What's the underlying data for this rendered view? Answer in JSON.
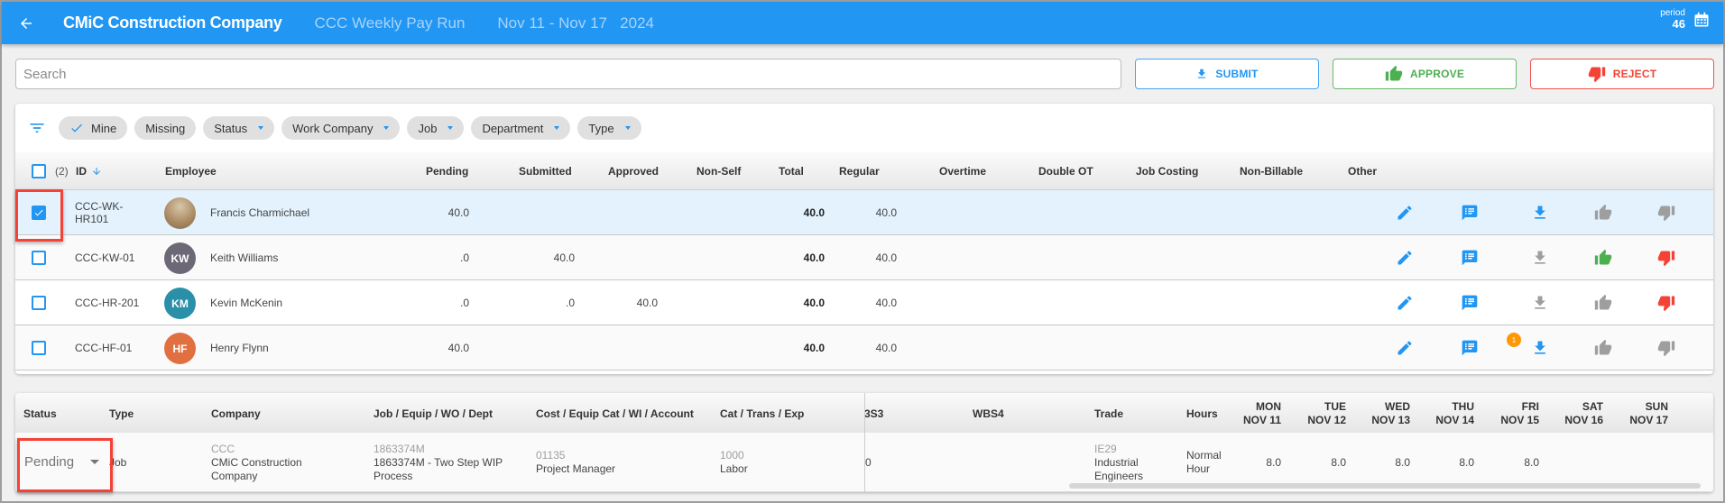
{
  "appbar": {
    "title": "CMiC Construction Company",
    "pay_run": "CCC Weekly Pay Run",
    "date_range": "Nov 11 - Nov 17",
    "year": "2024",
    "period_label": "period",
    "period_number": "46",
    "back_icon": "arrow-left-icon",
    "calendar_icon": "calendar-icon"
  },
  "search": {
    "placeholder": "Search",
    "value": ""
  },
  "actions": {
    "submit": "SUBMIT",
    "approve": "APPROVE",
    "reject": "REJECT"
  },
  "filters": {
    "chips": [
      {
        "label": "Mine",
        "checked": true
      },
      {
        "label": "Missing"
      },
      {
        "label": "Status",
        "dropdown": true
      },
      {
        "label": "Work Company",
        "dropdown": true
      },
      {
        "label": "Job",
        "dropdown": true
      },
      {
        "label": "Department",
        "dropdown": true
      },
      {
        "label": "Type",
        "dropdown": true
      }
    ]
  },
  "employee_table": {
    "selected_count": "(2)",
    "columns": [
      "ID",
      "Employee",
      "Pending",
      "Submitted",
      "Approved",
      "Non-Self",
      "Total",
      "Regular",
      "Overtime",
      "Double OT",
      "Job Costing",
      "Non-Billable",
      "Other"
    ],
    "rows": [
      {
        "checked": true,
        "id": "CCC-WK-HR101",
        "id_line1": "CCC-WK-",
        "id_line2": "HR101",
        "name": "Francis Charmichael",
        "initials": "",
        "avatar_color": "",
        "pending": "40.0",
        "submitted": "",
        "approved": "",
        "total": "40.0",
        "regular": "40.0",
        "download_active": true,
        "approve_state": "disabled",
        "reject_state": "disabled",
        "badge": ""
      },
      {
        "checked": false,
        "id": "CCC-KW-01",
        "name": "Keith Williams",
        "initials": "KW",
        "avatar_color": "#6d6875",
        "pending": ".0",
        "submitted": "40.0",
        "approved": "",
        "total": "40.0",
        "regular": "40.0",
        "download_active": false,
        "approve_state": "active",
        "reject_state": "active",
        "badge": ""
      },
      {
        "checked": false,
        "id": "CCC-HR-201",
        "name": "Kevin McKenin",
        "initials": "KM",
        "avatar_color": "#2a8fa8",
        "pending": ".0",
        "submitted": ".0",
        "approved": "40.0",
        "total": "40.0",
        "regular": "40.0",
        "download_active": false,
        "approve_state": "disabled",
        "reject_state": "active",
        "badge": ""
      },
      {
        "checked": false,
        "id": "CCC-HF-01",
        "name": "Henry Flynn",
        "initials": "HF",
        "avatar_color": "#e07040",
        "pending": "40.0",
        "submitted": "",
        "approved": "",
        "total": "40.0",
        "regular": "40.0",
        "download_active": true,
        "approve_state": "disabled",
        "reject_state": "disabled",
        "badge": "1"
      }
    ]
  },
  "detail_table": {
    "columns": {
      "status": "Status",
      "type": "Type",
      "company": "Company",
      "job": "Job / Equip / WO / Dept",
      "cost": "Cost / Equip Cat / WI / Account",
      "cat": "Cat / Trans / Exp",
      "wbs3": "3S3",
      "wbs4": "WBS4",
      "trade": "Trade",
      "hours": "Hours",
      "days": [
        {
          "day": "MON",
          "date": "NOV 11"
        },
        {
          "day": "TUE",
          "date": "NOV 12"
        },
        {
          "day": "WED",
          "date": "NOV 13"
        },
        {
          "day": "THU",
          "date": "NOV 14"
        },
        {
          "day": "FRI",
          "date": "NOV 15"
        },
        {
          "day": "SAT",
          "date": "NOV 16"
        },
        {
          "day": "SUN",
          "date": "NOV 17"
        }
      ]
    },
    "row": {
      "status": "Pending",
      "type": "Job",
      "company_code": "CCC",
      "company_name_1": "CMiC Construction",
      "company_name_2": "Company",
      "job_code": "1863374M",
      "job_name_1": "1863374M - Two Step WIP",
      "job_name_2": "Process",
      "cost_code": "01135",
      "cost_name": "Project Manager",
      "cat_code": "1000",
      "cat_name": "Labor",
      "wbs3": "0",
      "wbs4": "",
      "trade_code": "IE29",
      "trade_name_1": "Industrial",
      "trade_name_2": "Engineers",
      "hours_1": "Normal",
      "hours_2": "Hour",
      "day_values": [
        "8.0",
        "8.0",
        "8.0",
        "8.0",
        "8.0",
        "",
        ""
      ]
    }
  },
  "colors": {
    "primary": "#2196f3",
    "approve": "#4caf50",
    "reject": "#f44336",
    "disabled": "#9e9e9e",
    "badge": "#ff9800",
    "highlight_box": "#f44336"
  }
}
